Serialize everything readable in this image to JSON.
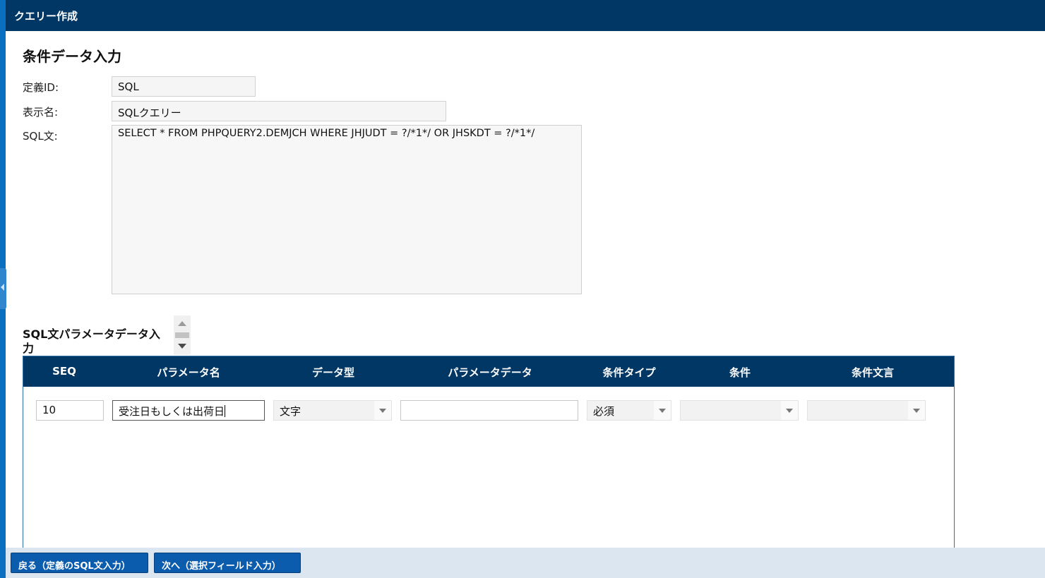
{
  "window": {
    "title": "クエリー作成"
  },
  "section": {
    "title": "条件データ入力"
  },
  "form": {
    "def_id_label": "定義ID:",
    "def_id_value": "SQL",
    "display_name_label": "表示名:",
    "display_name_value": "SQLクエリー",
    "sql_label": "SQL文:",
    "sql_value": "SELECT * FROM PHPQUERY2.DEMJCH WHERE JHJUDT = ?/*1*/ OR JHSKDT = ?/*1*/"
  },
  "params": {
    "title": "SQL文パラメータデータ入力",
    "headers": {
      "seq": "SEQ",
      "param_name": "パラメータ名",
      "data_type": "データ型",
      "param_data": "パラメータデータ",
      "cond_type": "条件タイプ",
      "cond": "条件",
      "cond_text": "条件文言"
    },
    "rows": [
      {
        "seq": "10",
        "param_name": "受注日もしくは出荷日",
        "data_type": "文字",
        "param_data": "",
        "cond_type": "必須",
        "cond": "",
        "cond_text": ""
      }
    ]
  },
  "footer": {
    "back_label": "戻る（定義のSQL文入力）",
    "next_label": "次へ（選択フィールド入力）"
  },
  "colors": {
    "header_bg": "#003764",
    "accent_strip": "#0a6fbf",
    "button_bg": "#0b5cad",
    "footer_bg": "#dce6f0"
  }
}
